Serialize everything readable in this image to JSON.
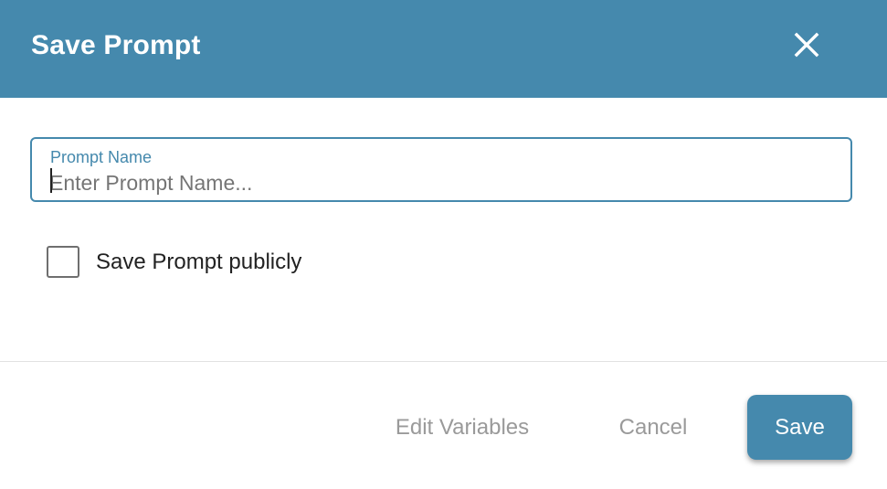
{
  "header": {
    "title": "Save Prompt",
    "close_icon": "close-icon"
  },
  "prompt_name_field": {
    "label": "Prompt Name",
    "value": "",
    "placeholder": "Enter Prompt Name..."
  },
  "public_checkbox": {
    "label": "Save Prompt publicly",
    "checked": false
  },
  "footer": {
    "edit_variables_label": "Edit Variables",
    "cancel_label": "Cancel",
    "save_label": "Save"
  },
  "colors": {
    "accent": "#4589ad",
    "disabled_text": "#9a9a9a"
  }
}
